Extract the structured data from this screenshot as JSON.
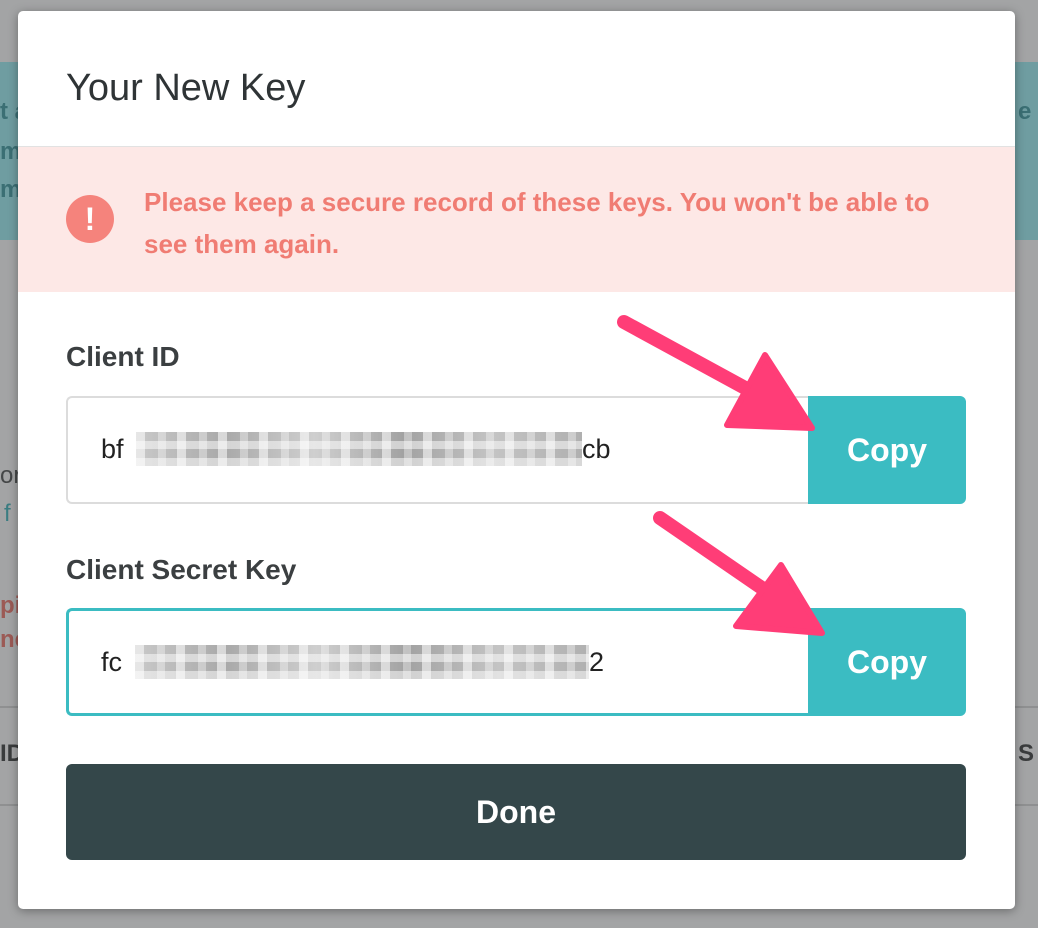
{
  "modal": {
    "title": "Your New Key",
    "alert": {
      "icon": "exclamation-icon",
      "icon_glyph": "!",
      "message": "Please keep a secure record of these keys. You won't be able to see them again."
    },
    "client_id": {
      "label": "Client ID",
      "visible_prefix": "bf",
      "visible_suffix": "cb",
      "masked": true,
      "copy_label": "Copy"
    },
    "client_secret": {
      "label": "Client Secret Key",
      "visible_prefix": "fc",
      "visible_suffix": "2",
      "masked": true,
      "copy_label": "Copy"
    },
    "done_label": "Done"
  },
  "background": {
    "fragments": [
      "t a",
      "m",
      "ma",
      "e",
      "or",
      "f",
      "pi",
      "ne",
      "ID",
      "S"
    ]
  },
  "colors": {
    "accent": "#3bbcc2",
    "alert_bg": "#fde8e6",
    "alert_text": "#f07c73",
    "primary_button": "#34474a",
    "annotation_arrow": "#ff3d77"
  }
}
